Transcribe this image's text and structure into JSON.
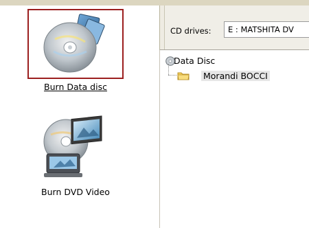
{
  "tasks": {
    "burn_data": {
      "label": "Burn Data disc",
      "selected": true
    },
    "burn_video": {
      "label": "Burn DVD Video"
    }
  },
  "drives": {
    "label": "CD drives:",
    "value": "E : MATSHITA DV"
  },
  "tree": {
    "root": {
      "label": "Data Disc"
    },
    "folder": {
      "label": "Morandi BOCCI"
    }
  },
  "colors": {
    "selection_border": "#9b1e1e",
    "panel_bg": "#f0eee7"
  }
}
